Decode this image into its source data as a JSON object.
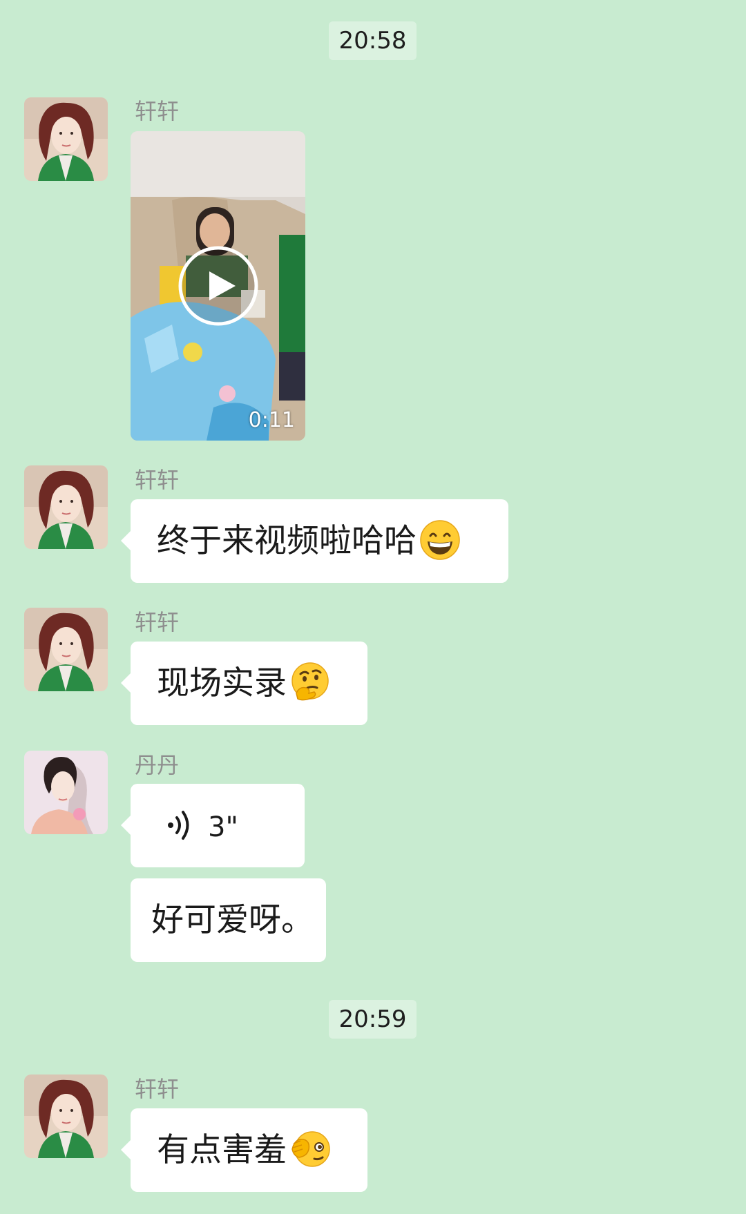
{
  "timestamps": [
    "20:58",
    "20:59"
  ],
  "messages": {
    "m1": {
      "sender": "轩轩",
      "type": "video",
      "duration": "0:11"
    },
    "m2": {
      "sender": "轩轩",
      "type": "text",
      "text": "终于来视频啦哈哈",
      "emoji": "grinning-face"
    },
    "m3": {
      "sender": "轩轩",
      "type": "text",
      "text": "现场实录",
      "emoji": "thinking-face"
    },
    "m4": {
      "sender": "丹丹",
      "type": "voice",
      "duration": "3\""
    },
    "m5": {
      "sender": "丹丹",
      "type": "text",
      "text": "好可爱呀。"
    },
    "m6": {
      "sender": "轩轩",
      "type": "text",
      "text": "有点害羞",
      "emoji": "face-with-hand-over-eye"
    }
  },
  "colors": {
    "background": "#c8ebd0",
    "bubble": "#ffffff",
    "timestamp_pill": "#dbf2e0",
    "sender_name": "#8e8e8e"
  }
}
